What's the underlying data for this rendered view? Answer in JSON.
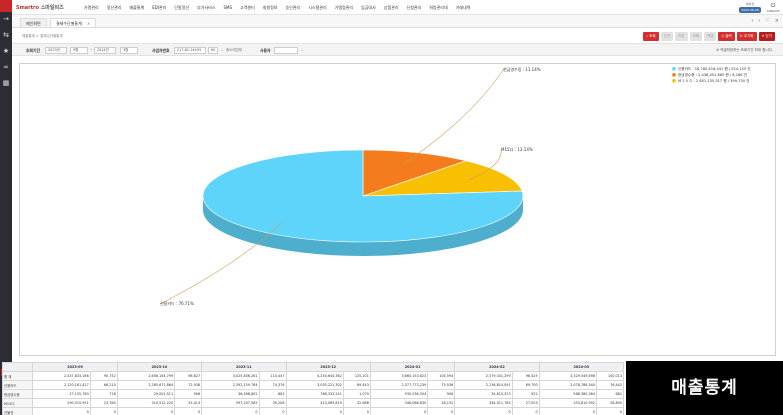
{
  "rail": {
    "badge": "AKE",
    "mini": [
      "MSG",
      "GUI",
      "PS"
    ]
  },
  "brand": {
    "name": "Smartro",
    "service": "스마일비즈"
  },
  "menu": [
    "가맹관리",
    "정산관리",
    "매출통계",
    "EDI관리",
    "단말정산",
    "부가서비스",
    "SMS",
    "고객센터",
    "회원정보",
    "승인관리",
    "시스템관리",
    "가맹점관리",
    "입금대사",
    "상품관리",
    "신청관리",
    "워킹관리대",
    "거래내역"
  ],
  "user": {
    "name": "에이전",
    "date": "2024-06-28",
    "logout": "LOGOUT"
  },
  "tabs": [
    {
      "label": "메인화면"
    },
    {
      "label": "결제수단별통계",
      "close": "×"
    }
  ],
  "breadcrumb": "매출통계 > 결제수단별통계",
  "buttons": {
    "search": "조회",
    "b2": "신규",
    "b3": "저장",
    "b4": "삭제",
    "b5": "엑셀",
    "print": "출력",
    "init": "초기화",
    "close": "닫기"
  },
  "filters": {
    "period_label": "조회기간",
    "from_year": "2023년",
    "from_month": "9월",
    "to_year": "2024년",
    "to_month": "3월",
    "biz_label": "사업자번호",
    "biz_value": "217-81-14493",
    "go": "60",
    "group": "중소매업체",
    "store_label": "사용자",
    "note": "※ 엑셀저장하는 조회기간 최대 합니다."
  },
  "chart_data": {
    "type": "pie",
    "labels": [
      "신용카드",
      "현금영수증",
      "M15ロ"
    ],
    "values": [
      76.71,
      11.14,
      12.14
    ],
    "colors": [
      "#5fd4fb",
      "#f47c1c",
      "#f8c000"
    ],
    "slice_labels": [
      "신용카드 : 76.71%",
      "현금영수증 : 11.14%",
      "M15ロ : 12.14%"
    ],
    "legend": [
      "신용카드 : 16,780,416,441 원 / 524,155 건",
      "현금영수증 : 2,436,451,665 원 / 6,166 건",
      "M 1 5 ㅁ : 2,651,135,317 원 / 399,730 건"
    ],
    "legend_position": "top-right"
  },
  "table": {
    "corner": "합 계",
    "months": [
      "2023-09",
      "2023-10",
      "2023-11",
      "2023-12",
      "2024-01",
      "2024-02",
      "2024-03"
    ],
    "rows": [
      {
        "label": "합 계",
        "cells": [
          "2,437,833,166",
          "90,752",
          "2,606,154,799",
          "98,627",
          "3,025,836,261",
          "114,447",
          "4,254,644,362",
          "125,201",
          "3,660,153,623",
          "104,594",
          "2,579,341,299",
          "96,425",
          "3,329,549,898",
          "100,013"
        ]
      },
      {
        "label": "신용카드",
        "cells": [
          "2,120,161,427",
          "66,210",
          "2,265,671,864",
          "72,938",
          "2,392,159,784",
          "74,376",
          "3,055,221,302",
          "89,443",
          "2,377,773,239",
          "75,536",
          "2,136,614,091",
          "69,700",
          "2,078,788,540",
          "76,442"
        ]
      },
      {
        "label": "현금영수증",
        "cells": [
          "27,155,780",
          "718",
          "29,001,511",
          "906",
          "36,468,802",
          "863",
          "786,333,241",
          "1,070",
          "935,036,554",
          "906",
          "34,815,323",
          "922",
          "588,380,364",
          "681"
        ]
      },
      {
        "label": "M15ロ",
        "cells": [
          "290,515,951",
          "23,784",
          "310,512,220",
          "25,413",
          "597,207,585",
          "39,208",
          "413,069,819",
          "32,688",
          "346,086,830",
          "28,152",
          "344,911,785",
          "27,003",
          "353,810,992",
          "28,690"
        ]
      },
      {
        "label": "선불전",
        "cells": [
          "0",
          "0",
          "0",
          "0",
          "0",
          "0",
          "0",
          "0",
          "0",
          "0",
          "0",
          "0",
          "0",
          "0"
        ]
      }
    ]
  },
  "overlay": "매출통계"
}
